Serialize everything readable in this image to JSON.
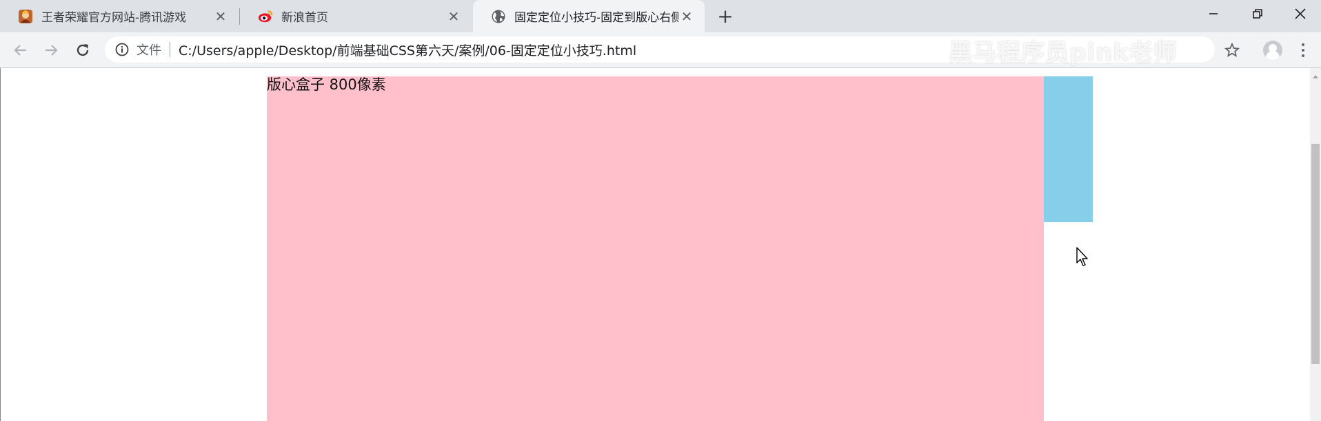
{
  "browser": {
    "tabs": [
      {
        "title": "王者荣耀官方网站-腾讯游戏",
        "favicon": "game-icon",
        "active": false
      },
      {
        "title": "新浪首页",
        "favicon": "weibo-eye-icon",
        "active": false
      },
      {
        "title": "固定定位小技巧-固定到版心右侧",
        "favicon": "globe-icon",
        "active": true
      }
    ],
    "new_tab_label": "+",
    "close_glyph": "✕"
  },
  "toolbar": {
    "scheme_label": "文件",
    "url": "C:/Users/apple/Desktop/前端基础CSS第六天/案例/06-固定定位小技巧.html",
    "watermark": "黑马程序员pink老师"
  },
  "page": {
    "w_box_text": "版心盒子 800像素"
  },
  "colors": {
    "w_box_bg": "#ffc0cb",
    "fixed_box_bg": "#87ceeb",
    "tabstrip_bg": "#dee1e6",
    "toolbar_bg": "#f2f3f5"
  }
}
